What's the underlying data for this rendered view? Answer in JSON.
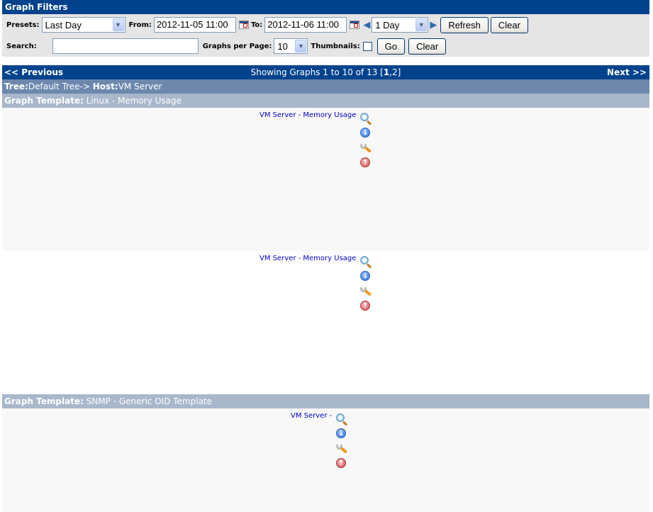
{
  "filters": {
    "title": "Graph Filters",
    "presets_label": "Presets:",
    "presets_value": "Last Day",
    "from_label": "From:",
    "from_value": "2012-11-05 11:00",
    "to_label": "To:",
    "to_value": "2012-11-06 11:00",
    "timespan_value": "1 Day",
    "refresh_label": "Refresh",
    "clear_label": "Clear",
    "search_label": "Search:",
    "search_value": "",
    "graphs_per_page_label": "Graphs per Page:",
    "graphs_per_page_value": "10",
    "thumbnails_label": "Thumbnails:",
    "thumbnails_checked": false,
    "go_label": "Go",
    "clear2_label": "Clear"
  },
  "nav": {
    "previous": "<< Previous",
    "showing_prefix": "Showing Graphs 1 to 10 of 13 [",
    "current_page": "1",
    "other_pages": ",2]",
    "next": "Next >>"
  },
  "tree_row": {
    "tree_label": "Tree:",
    "tree_value": "Default Tree->",
    "host_label": "Host:",
    "host_value": "VM Server"
  },
  "templates": [
    {
      "label": "Graph Template:",
      "name": "Linux - Memory Usage",
      "graphs": [
        {
          "title": "VM Server - Memory Usage"
        },
        {
          "title": "VM Server - Memory Usage"
        }
      ]
    },
    {
      "label": "Graph Template:",
      "name": "SNMP - Generic OID Template",
      "graphs": [
        {
          "title": "VM Server -"
        }
      ]
    }
  ],
  "icons": [
    "zoom-icon",
    "export-icon",
    "properties-icon",
    "move-up-icon"
  ]
}
